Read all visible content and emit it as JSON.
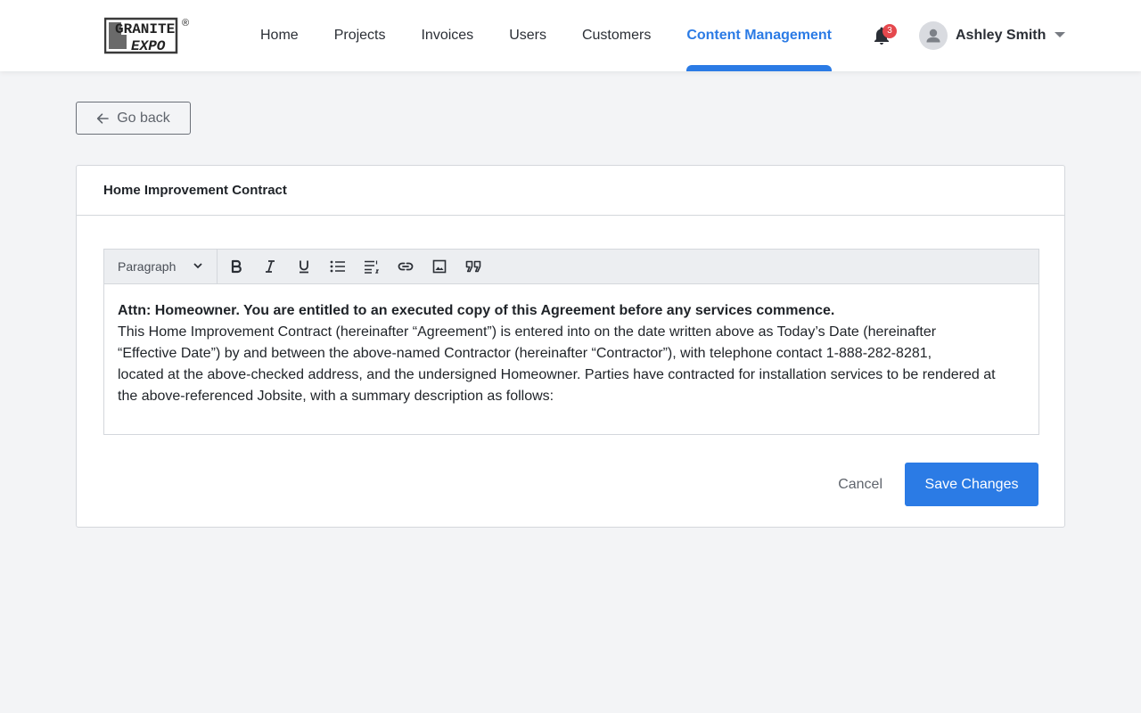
{
  "header": {
    "logo_text_top": "GRANITE",
    "logo_text_bottom": "EXPO",
    "logo_mark": "®",
    "nav": [
      {
        "label": "Home"
      },
      {
        "label": "Projects"
      },
      {
        "label": "Invoices"
      },
      {
        "label": "Users"
      },
      {
        "label": "Customers"
      },
      {
        "label": "Content Management",
        "active": true
      }
    ],
    "notifications_count": "3",
    "user_name": "Ashley Smith",
    "icons": {
      "bell": "bell-icon",
      "avatar": "user-avatar-icon",
      "caret": "caret-down-icon"
    }
  },
  "back": {
    "label": "Go back",
    "icon": "arrow-left-icon"
  },
  "card": {
    "title": "Home Improvement Contract",
    "toolbar": {
      "block_format": "Paragraph",
      "tools": [
        "bold-icon",
        "italic-icon",
        "underline-icon",
        "bulleted-list-icon",
        "numbered-list-icon",
        "link-icon",
        "image-icon",
        "blockquote-icon"
      ]
    },
    "content": {
      "lead": "Attn: Homeowner. You are entitled to an executed copy of this Agreement before any services commence.",
      "line1": "This Home Improvement Contract (hereinafter “Agreement”) is entered into on the date written above as Today’s Date (hereinafter",
      "line2": "“Effective Date”) by and between the above-named Contractor (hereinafter “Contractor”), with telephone contact 1-888-282-8281,",
      "line3": "located at the above-checked address, and the undersigned Homeowner. Parties have contracted for installation services to be rendered at",
      "line4": "the above-referenced Jobsite, with a summary description as follows:"
    },
    "actions": {
      "cancel": "Cancel",
      "save": "Save Changes"
    }
  },
  "colors": {
    "accent": "#2b7be5",
    "badge": "#e5484d",
    "background": "#f3f4f6"
  }
}
